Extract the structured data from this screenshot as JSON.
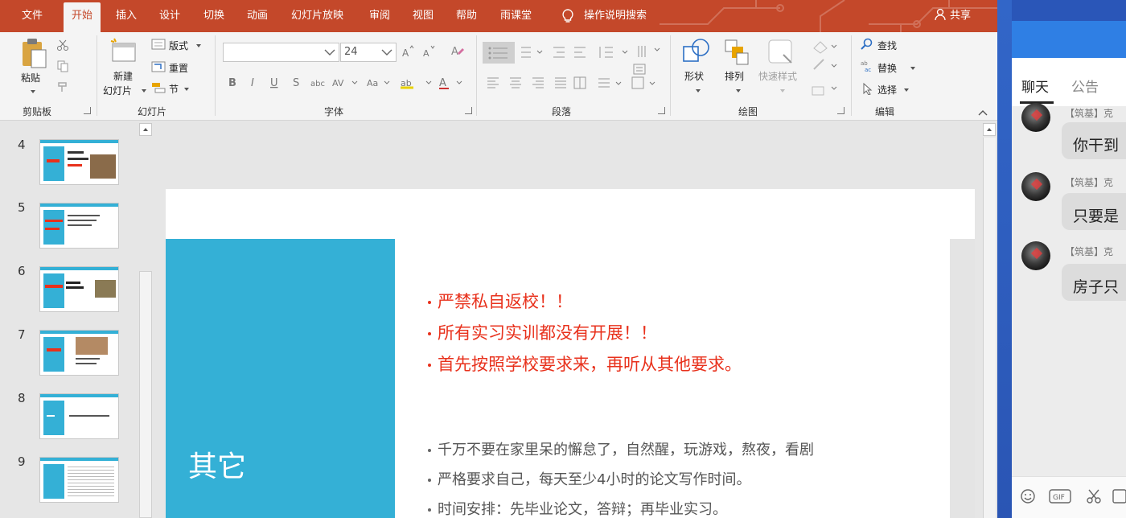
{
  "ribbon_tabs": {
    "file": "文件",
    "home": "开始",
    "insert": "插入",
    "design": "设计",
    "transitions": "切换",
    "animations": "动画",
    "slideshow": "幻灯片放映",
    "review": "审阅",
    "view": "视图",
    "help": "帮助",
    "rain_classroom": "雨课堂",
    "tell_me": "操作说明搜索",
    "share": "共享"
  },
  "ribbon": {
    "clipboard": {
      "paste": "粘贴",
      "group": "剪贴板"
    },
    "slides": {
      "new_slide_line1": "新建",
      "new_slide_line2": "幻灯片",
      "layout": "版式",
      "reset": "重置",
      "section": "节",
      "group": "幻灯片"
    },
    "font": {
      "font_size": "24",
      "group": "字体"
    },
    "paragraph": {
      "group": "段落"
    },
    "drawing": {
      "shapes": "形状",
      "arrange": "排列",
      "quick_styles": "快速样式",
      "group": "绘图"
    },
    "editing": {
      "find": "查找",
      "replace": "替换",
      "select": "选择",
      "group": "编辑"
    }
  },
  "thumbnails": [
    {
      "number": "4"
    },
    {
      "number": "5"
    },
    {
      "number": "6"
    },
    {
      "number": "7"
    },
    {
      "number": "8"
    },
    {
      "number": "9"
    }
  ],
  "slide": {
    "title": "其它",
    "red_bullets": [
      "严禁私自返校！！",
      "所有实习实训都没有开展！！",
      "首先按照学校要求来，再听从其他要求。"
    ],
    "gray_bullets": [
      "千万不要在家里呆的懈怠了，自然醒，玩游戏，熬夜，看剧",
      "严格要求自己，每天至少4小时的论文写作时间。",
      "时间安排：先毕业论文，答辩；再毕业实习。"
    ]
  },
  "chat": {
    "tabs": {
      "chat": "聊天",
      "notice": "公告"
    },
    "messages": [
      {
        "sender": "【筑基】克",
        "text": "你干到"
      },
      {
        "sender": "【筑基】克",
        "text": "只要是"
      },
      {
        "sender": "【筑基】克",
        "text": "房子只"
      }
    ]
  },
  "colors": {
    "ribbon_accent": "#c4482a",
    "slide_blue": "#34b0d6",
    "emphasis_red": "#e8311c",
    "chat_header": "#2f7fe4"
  }
}
